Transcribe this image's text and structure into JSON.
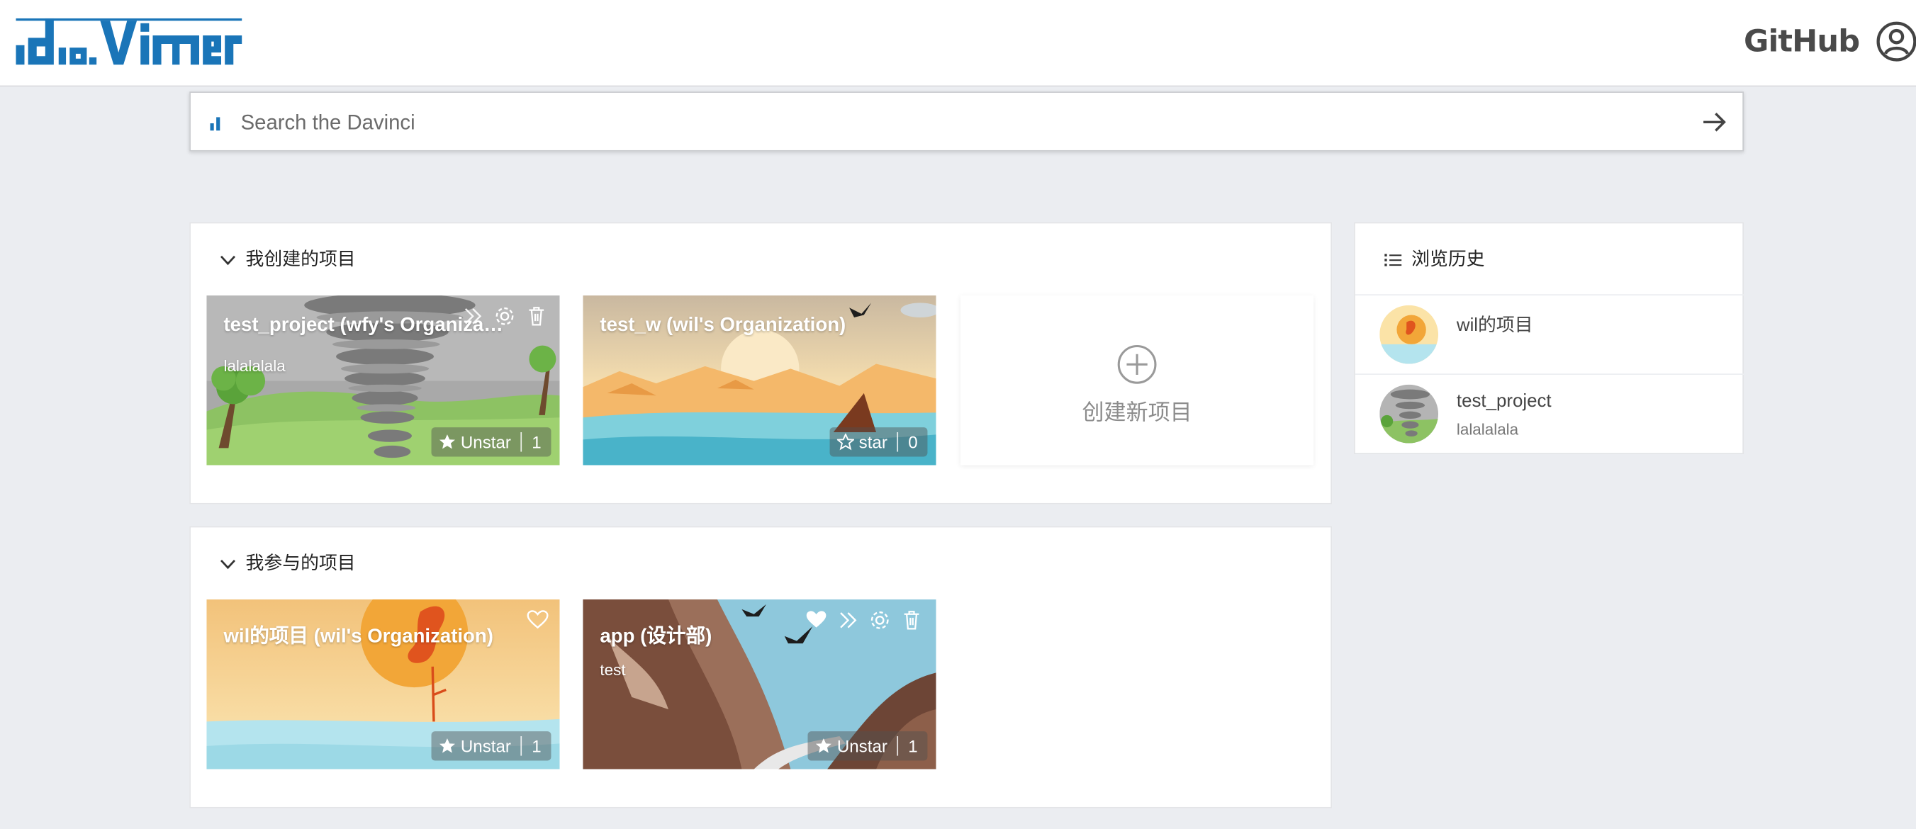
{
  "header": {
    "github_label": "GitHub"
  },
  "search": {
    "placeholder": "Search the Davinci"
  },
  "my_projects": {
    "heading": "我创建的项目",
    "cards": [
      {
        "title": "test_project (wfy's Organization)",
        "description": "lalalalala",
        "star_label": "Unstar",
        "star_count": "1"
      },
      {
        "title": "test_w (wil's Organization)",
        "description": "",
        "star_label": "star",
        "star_count": "0"
      }
    ],
    "create_label": "创建新项目"
  },
  "joined_projects": {
    "heading": "我参与的项目",
    "cards": [
      {
        "title": "wil的项目 (wil's Organization)",
        "description": "",
        "star_label": "Unstar",
        "star_count": "1"
      },
      {
        "title": "app (设计部)",
        "description": "test",
        "star_label": "Unstar",
        "star_count": "1"
      }
    ]
  },
  "history": {
    "heading": "浏览历史",
    "items": [
      {
        "name": "wil的项目",
        "description": ""
      },
      {
        "name": "test_project",
        "description": "lalalalala"
      }
    ]
  },
  "colors": {
    "brand_blue": "#1a75b8",
    "page_bg": "#ebedf1"
  },
  "icons": [
    "davinci-logo",
    "github-logo",
    "user-icon",
    "search-bars-icon",
    "arrow-right-icon",
    "chevron-down-icon",
    "list-icon",
    "transfer-icon",
    "gear-icon",
    "trash-icon",
    "heart-icon",
    "star-icon",
    "plus-circle-icon"
  ]
}
